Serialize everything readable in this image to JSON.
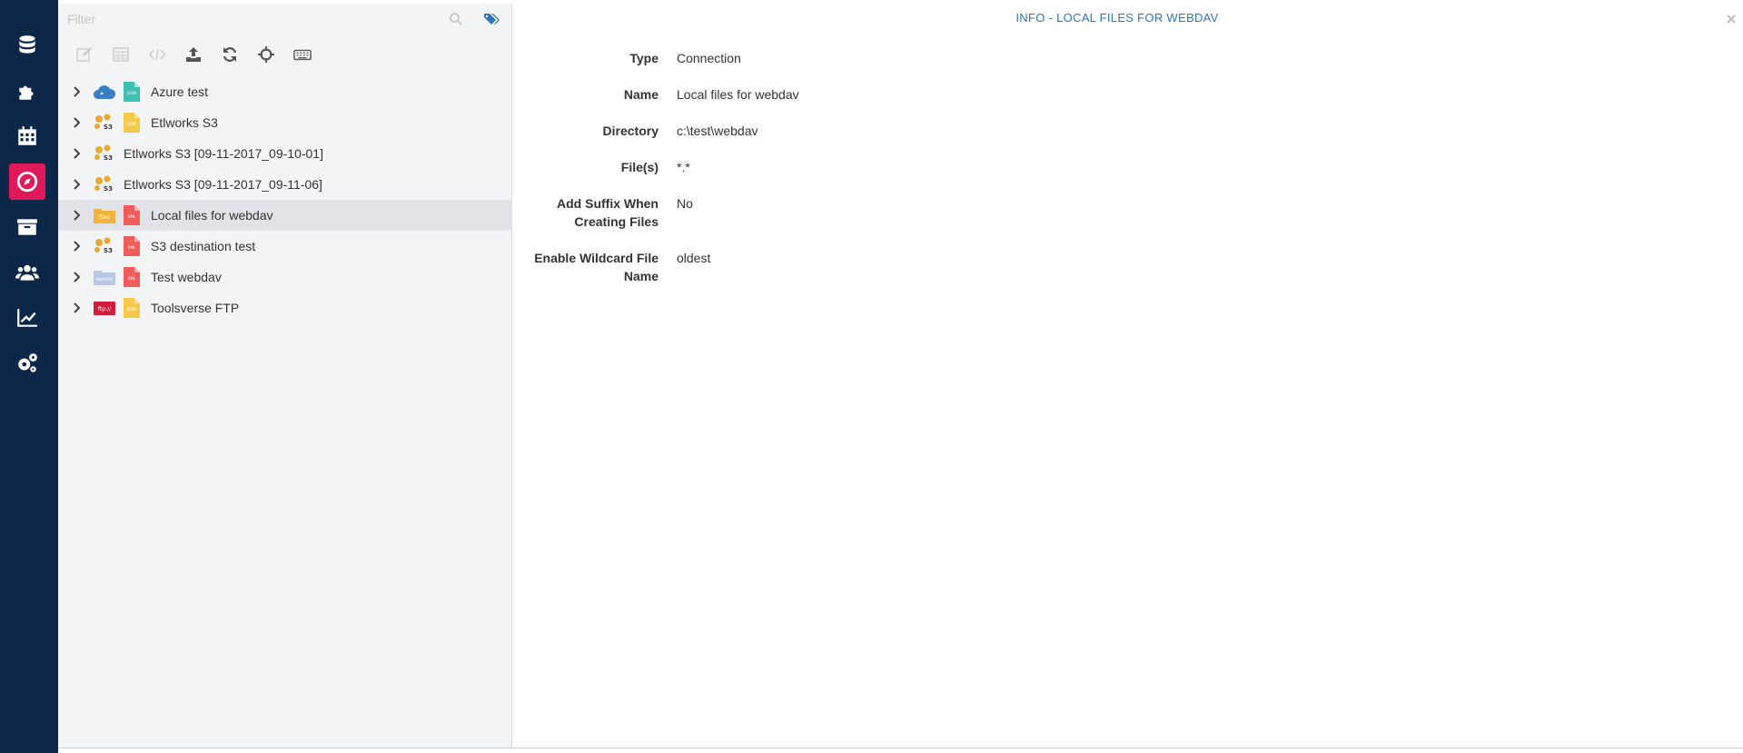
{
  "nav": {
    "items": [
      {
        "name": "nav-connections",
        "icon": "database-icon",
        "active": false
      },
      {
        "name": "nav-formats",
        "icon": "puzzle-icon",
        "active": false
      },
      {
        "name": "nav-schedules",
        "icon": "calendar-icon",
        "active": false
      },
      {
        "name": "nav-explorer",
        "icon": "compass-icon",
        "active": true
      },
      {
        "name": "nav-archive",
        "icon": "archive-icon",
        "active": false
      },
      {
        "name": "nav-users",
        "icon": "users-icon",
        "active": false
      },
      {
        "name": "nav-statistics",
        "icon": "chart-line-icon",
        "active": false
      },
      {
        "name": "nav-settings",
        "icon": "gears-icon",
        "active": false
      }
    ],
    "active_color": "#e0195a",
    "background": "#0d2748"
  },
  "filter": {
    "placeholder": "Filter",
    "value": ""
  },
  "toolbar": {
    "buttons": [
      {
        "name": "edit-button",
        "icon": "edit-icon",
        "enabled": false
      },
      {
        "name": "table-button",
        "icon": "table-icon",
        "enabled": false
      },
      {
        "name": "code-button",
        "icon": "code-icon",
        "enabled": false
      },
      {
        "name": "upload-button",
        "icon": "upload-icon",
        "enabled": true
      },
      {
        "name": "refresh-button",
        "icon": "refresh-icon",
        "enabled": true
      },
      {
        "name": "locate-button",
        "icon": "crosshairs-icon",
        "enabled": true
      },
      {
        "name": "keyboard-button",
        "icon": "keyboard-icon",
        "enabled": true
      }
    ]
  },
  "tree": {
    "items": [
      {
        "label": "Azure test",
        "conn_icon": "azure-cloud-icon",
        "format_icon": "json-file-icon"
      },
      {
        "label": "Etlworks S3",
        "conn_icon": "s3-icon",
        "format_icon": "json-file-icon"
      },
      {
        "label": "Etlworks S3 [09-11-2017_09-10-01]",
        "conn_icon": "s3-icon",
        "format_icon": ""
      },
      {
        "label": "Etlworks S3 [09-11-2017_09-11-06]",
        "conn_icon": "s3-icon",
        "format_icon": ""
      },
      {
        "label": "Local files for webdav",
        "conn_icon": "file-system-icon",
        "format_icon": "xml-file-icon",
        "selected": true
      },
      {
        "label": "S3 destination test",
        "conn_icon": "s3-icon",
        "format_icon": "xml-file-icon"
      },
      {
        "label": "Test webdav",
        "conn_icon": "webdav-icon",
        "format_icon": "xml-file-icon"
      },
      {
        "label": "Toolsverse FTP",
        "conn_icon": "ftp-icon",
        "format_icon": "json-file-icon"
      }
    ]
  },
  "info": {
    "title": "INFO - LOCAL FILES FOR WEBDAV",
    "properties": [
      {
        "key": "Type",
        "value": "Connection"
      },
      {
        "key": "Name",
        "value": "Local files for webdav"
      },
      {
        "key": "Directory",
        "value": "c:\\test\\webdav"
      },
      {
        "key": "File(s)",
        "value": "*.*"
      },
      {
        "key": "Add Suffix When Creating Files",
        "value": "No"
      },
      {
        "key": "Enable Wildcard File Name",
        "value": "oldest"
      }
    ]
  },
  "icon_labels": {
    "s3": "S3",
    "json": "JSON",
    "xml": "XML",
    "ftp": "ftp://",
    "files": "files",
    "webdav": "WebDAV"
  }
}
